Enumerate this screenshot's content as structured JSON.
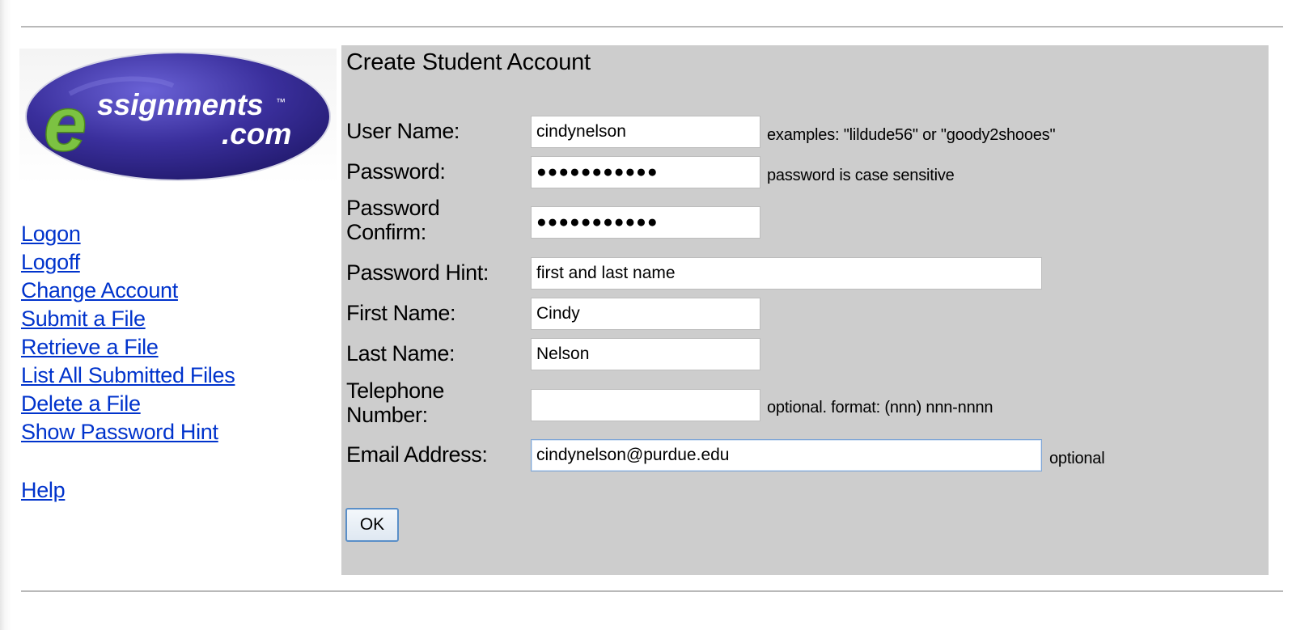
{
  "logo": {
    "line1": "ssignments",
    "line2": ".com",
    "tm": "™",
    "letter": "e"
  },
  "nav": {
    "items": [
      "Logon",
      "Logoff",
      "Change Account",
      "Submit a File",
      "Retrieve a File",
      "List All Submitted Files",
      "Delete a File",
      "Show Password Hint"
    ],
    "help": "Help"
  },
  "form": {
    "title": "Create Student Account",
    "username": {
      "label": "User Name:",
      "value": "cindynelson",
      "note": "examples: \"lildude56\" or \"goody2shooes\""
    },
    "password": {
      "label": "Password:",
      "value": "●●●●●●●●●●●",
      "note": "password is case sensitive"
    },
    "password_confirm": {
      "label_line1": "Password",
      "label_line2": "Confirm:",
      "value": "●●●●●●●●●●●"
    },
    "password_hint": {
      "label": "Password Hint:",
      "value": "first and last name"
    },
    "first_name": {
      "label": "First Name:",
      "value": "Cindy"
    },
    "last_name": {
      "label": "Last Name:",
      "value": "Nelson"
    },
    "telephone": {
      "label_line1": "Telephone",
      "label_line2": "Number:",
      "value": "",
      "note": "optional. format: (nnn) nnn-nnnn"
    },
    "email": {
      "label": "Email Address:",
      "value": "cindynelson@purdue.edu",
      "note": "optional"
    },
    "ok_label": "OK"
  },
  "colors": {
    "link": "#0033cc",
    "panel": "#cdcdcd",
    "logo_ellipse": "#3b2f9a",
    "logo_e": "#7cc242"
  }
}
